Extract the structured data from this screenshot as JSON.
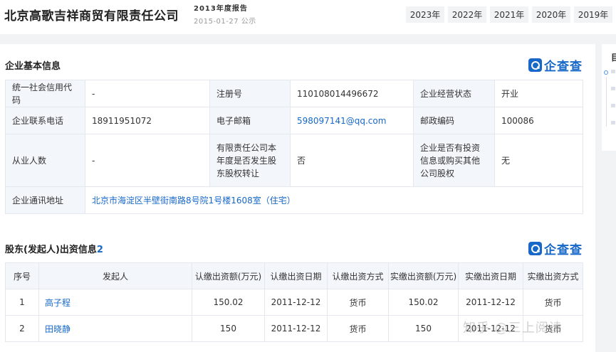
{
  "header": {
    "company_name": "北京高歌吉祥商贸有限责任公司",
    "report_title": "2013年度报告",
    "report_date": "2015-01-27 公示",
    "years": [
      "2023年",
      "2022年",
      "2021年",
      "2020年",
      "2019年"
    ]
  },
  "basic_info": {
    "title": "企业基本信息",
    "logo_text": "企查查",
    "rows": [
      [
        {
          "label": "统一社会信用代码",
          "value": "-"
        },
        {
          "label": "注册号",
          "value": "110108014496672"
        },
        {
          "label": "企业经营状态",
          "value": "开业"
        }
      ],
      [
        {
          "label": "企业联系电话",
          "value": "18911951072"
        },
        {
          "label": "电子邮箱",
          "value": "598097141@qq.com"
        },
        {
          "label": "邮政编码",
          "value": "100086"
        }
      ],
      [
        {
          "label": "从业人数",
          "value": "-"
        },
        {
          "label": "有限责任公司本年度是否发生股东股权转让",
          "value": "否"
        },
        {
          "label": "企业是否有投资信息或购买其他公司股权",
          "value": "无"
        }
      ]
    ],
    "address_label": "企业通讯地址",
    "address_value": "北京市海淀区半壁街南路8号院1号楼1608室（住宅）"
  },
  "shareholders": {
    "title": "股东(发起人)出资信息",
    "count": "2",
    "logo_text": "企查查",
    "columns": [
      "序号",
      "发起人",
      "认缴出资额(万元)",
      "认缴出资日期",
      "认缴出资方式",
      "实缴出资额(万元)",
      "实缴出资日期",
      "实缴出资方式"
    ],
    "rows": [
      [
        "1",
        "高子程",
        "150.02",
        "2011-12-12",
        "货币",
        "150.02",
        "2011-12-12",
        "货币"
      ],
      [
        "2",
        "田晓静",
        "150",
        "2011-12-12",
        "货币",
        "150",
        "2011-12-12",
        "货币"
      ]
    ]
  },
  "side_nav": {
    "label": "目"
  },
  "watermark": "知乎 @三上阅读",
  "colors": {
    "accent": "#1768c8",
    "label_bg": "#f3f6fb",
    "page_bg": "#f2f3f5"
  }
}
